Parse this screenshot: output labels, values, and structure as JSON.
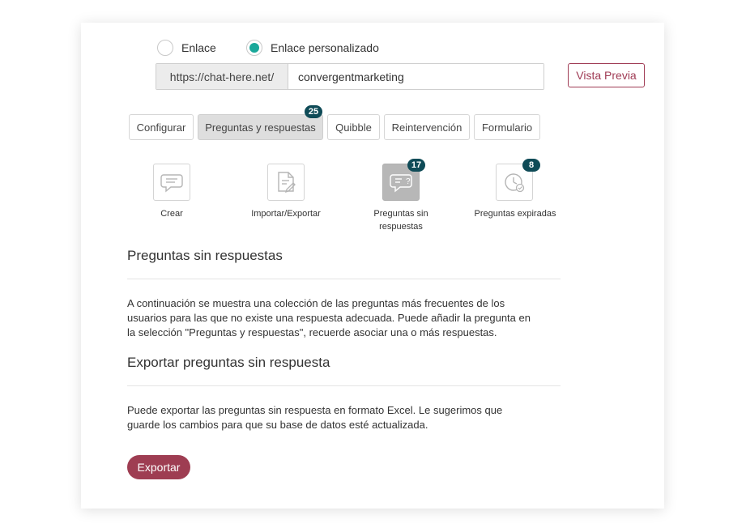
{
  "link_options": {
    "option_link": "Enlace",
    "option_custom_link": "Enlace personalizado",
    "selected": "custom"
  },
  "url": {
    "prefix": "https://chat-here.net/",
    "value": "convergentmarketing"
  },
  "preview_button": "Vista Previa",
  "tabs": [
    {
      "label": "Configurar"
    },
    {
      "label": "Preguntas y respuestas",
      "badge": "25",
      "active": true
    },
    {
      "label": "Quibble"
    },
    {
      "label": "Reintervención"
    },
    {
      "label": "Formulario"
    }
  ],
  "tools": [
    {
      "label": "Crear",
      "icon": "chat-bubble-icon"
    },
    {
      "label": "Importar/Exportar",
      "icon": "document-edit-icon"
    },
    {
      "label_line1": "Preguntas sin",
      "label_line2": "respuestas",
      "icon": "question-bubble-icon",
      "badge": "17",
      "active": true
    },
    {
      "label": "Preguntas expiradas",
      "icon": "clock-check-icon",
      "badge": "8"
    }
  ],
  "section1": {
    "title": "Preguntas sin respuestas",
    "line1": "A continuación se muestra una colección de las preguntas más frecuentes de los",
    "line2": "usuarios para las que no existe una respuesta adecuada. Puede añadir la pregunta en",
    "line3": "la selección \"Preguntas y respuestas\", recuerde asociar una o más respuestas."
  },
  "section2": {
    "title": "Exportar preguntas sin respuesta",
    "line1": "Puede exportar las preguntas sin respuesta en formato Excel. Le sugerimos que",
    "line2": "guarde los cambios para que su base de datos esté actualizada."
  },
  "export_button": "Exportar",
  "colors": {
    "accent_teal": "#1aa89a",
    "badge_dark": "#0f4b57",
    "brand_wine": "#9e3d52"
  }
}
